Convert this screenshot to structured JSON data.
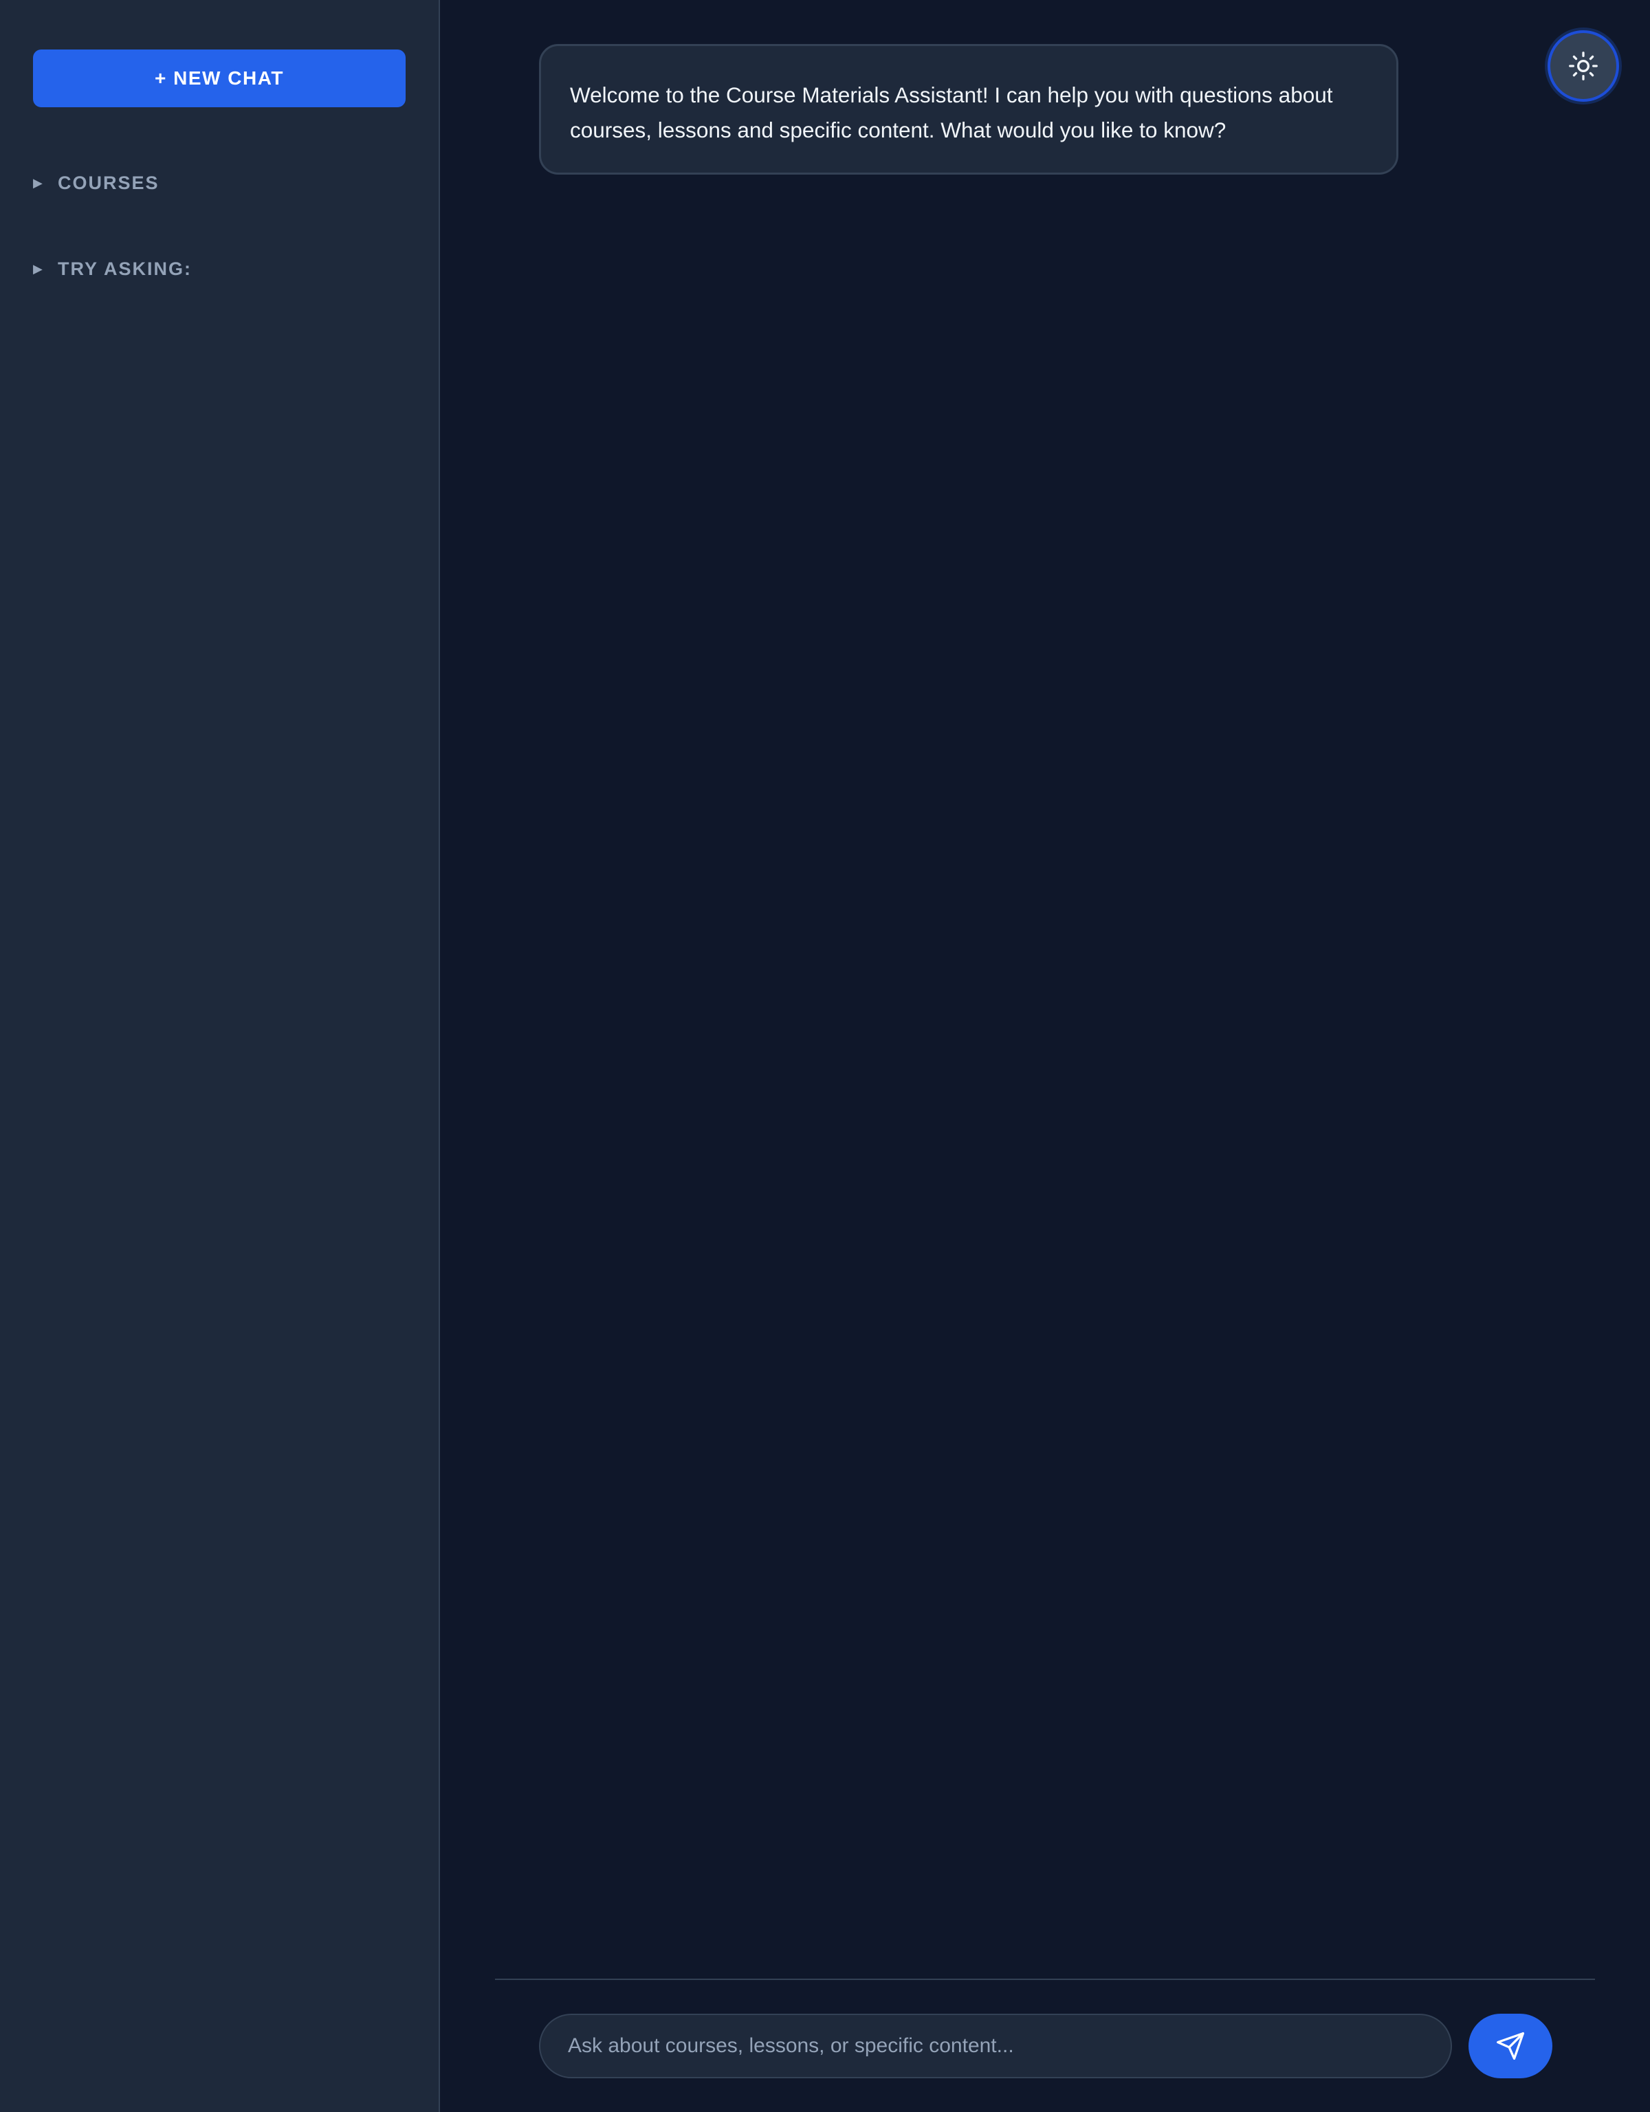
{
  "sidebar": {
    "new_chat_label": "+ NEW CHAT",
    "sections": [
      {
        "label": "COURSES",
        "expanded": false
      },
      {
        "label": "TRY ASKING:",
        "expanded": false
      }
    ]
  },
  "chat": {
    "welcome_message": "Welcome to the Course Materials Assistant! I can help you with questions about courses, lessons and specific content. What would you like to know?",
    "input_value": "",
    "input_placeholder": "Ask about courses, lessons, or specific content..."
  },
  "icons": {
    "theme_toggle": "sun-icon",
    "send": "send-icon",
    "section_toggle": "triangle-right-icon"
  },
  "colors": {
    "background": "#0f172a",
    "sidebar": "#1e293b",
    "accent": "#2563eb",
    "text": "#f1f5f9",
    "muted": "#94a3b8",
    "border": "#334155"
  }
}
